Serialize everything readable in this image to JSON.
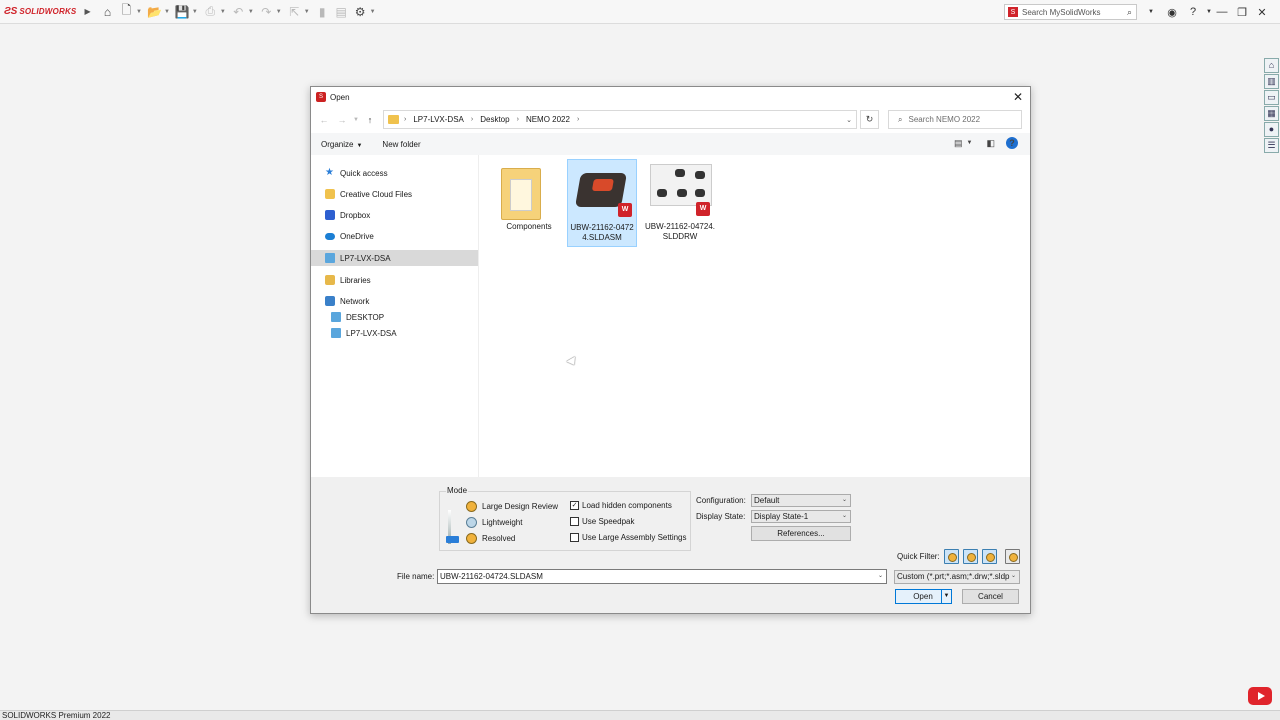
{
  "app": {
    "brand": "SOLIDWORKS",
    "search_placeholder": "Search MySolidWorks",
    "status": "SOLIDWORKS Premium 2022"
  },
  "dialog": {
    "title": "Open",
    "breadcrumb": [
      "LP7-LVX-DSA",
      "Desktop",
      "NEMO 2022"
    ],
    "search_placeholder": "Search NEMO 2022",
    "organize_label": "Organize",
    "new_folder_label": "New folder",
    "nav": {
      "quick_access": "Quick access",
      "creative_cloud": "Creative Cloud Files",
      "dropbox": "Dropbox",
      "onedrive": "OneDrive",
      "this_pc": "LP7-LVX-DSA",
      "libraries": "Libraries",
      "network": "Network",
      "desktop": "DESKTOP",
      "lp7": "LP7-LVX-DSA"
    },
    "files": [
      {
        "name": "Components",
        "type": "folder"
      },
      {
        "name": "UBW-21162-04724.SLDASM",
        "type": "assembly"
      },
      {
        "name": "UBW-21162-04724.SLDDRW",
        "type": "drawing"
      }
    ],
    "mode": {
      "legend": "Mode",
      "large_design_review": "Large Design Review",
      "lightweight": "Lightweight",
      "resolved": "Resolved"
    },
    "options": {
      "load_hidden": "Load hidden components",
      "load_hidden_checked": true,
      "use_speedpak": "Use Speedpak",
      "use_speedpak_checked": false,
      "large_assembly": "Use Large Assembly Settings",
      "large_assembly_checked": false
    },
    "configuration_label": "Configuration:",
    "configuration_value": "Default",
    "display_state_label": "Display State:",
    "display_state_value": "Display State-1",
    "references_label": "References...",
    "quick_filter_label": "Quick Filter:",
    "file_name_label": "File name:",
    "file_name_value": "UBW-21162-04724.SLDASM",
    "file_type_value": "Custom (*.prt;*.asm;*.drw;*.sldp",
    "open_label": "Open",
    "cancel_label": "Cancel"
  }
}
